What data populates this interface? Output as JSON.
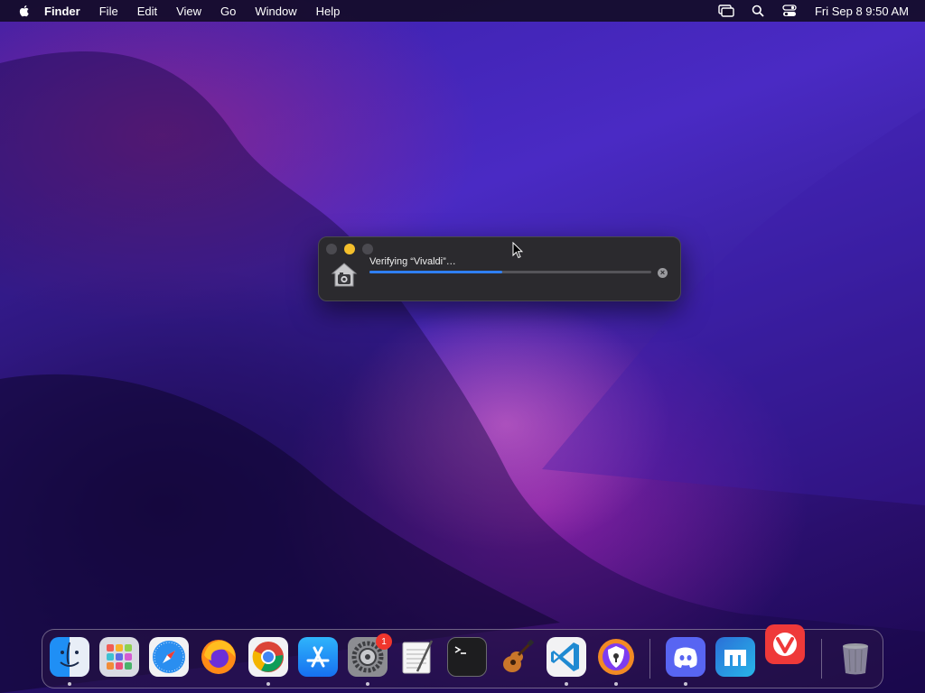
{
  "menubar": {
    "app_name": "Finder",
    "menus": [
      "File",
      "Edit",
      "View",
      "Go",
      "Window",
      "Help"
    ],
    "clock": "Fri Sep 8  9:50 AM"
  },
  "dialog": {
    "label": "Verifying “Vivaldi”…",
    "progress_percent": 47
  },
  "dock": {
    "apps": [
      "Finder",
      "Launchpad",
      "Safari",
      "Firefox",
      "Chrome",
      "App Store",
      "System Settings",
      "TextEdit",
      "Terminal",
      "GarageBand",
      "Visual Studio Code",
      "Brave",
      "Discord",
      "Maxthon",
      "Vivaldi",
      "Trash"
    ],
    "settings_badge": "1"
  }
}
